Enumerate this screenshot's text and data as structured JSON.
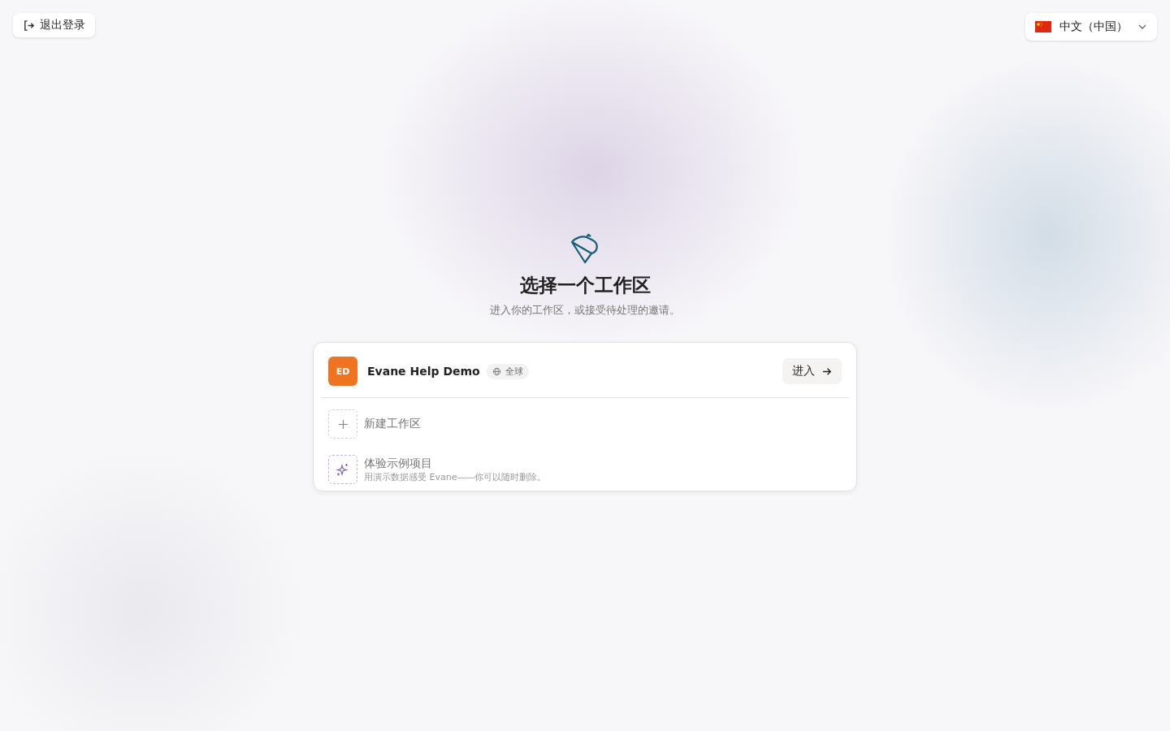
{
  "logout_button": {
    "label": "退出登录"
  },
  "language_select": {
    "value": "中文（中国）"
  },
  "title": "选择一个工作区",
  "subtitle": "进入你的工作区，或接受待处理的邀请。",
  "workspaces": [
    {
      "initials": "ED",
      "name": "Evane Help Demo",
      "badge": "全球",
      "enter_label": "进入"
    }
  ],
  "actions": [
    {
      "kind": "create",
      "label": "新建工作区"
    },
    {
      "kind": "sample",
      "label": "体验示例项目",
      "description": "用演示数据感受 Evane——你可以随时删除。"
    }
  ]
}
